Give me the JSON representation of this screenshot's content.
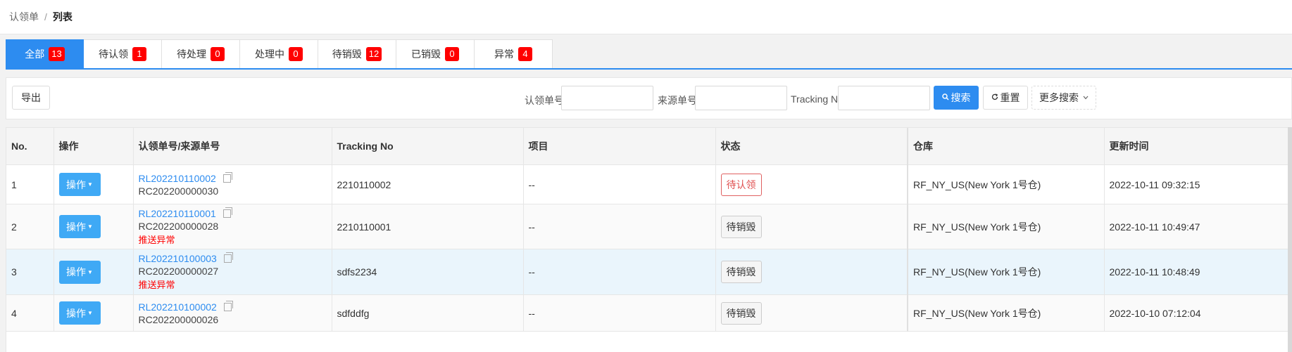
{
  "breadcrumb": {
    "parent": "认领单",
    "separator": "/",
    "current": "列表"
  },
  "tabs": [
    {
      "label": "全部",
      "count": "13",
      "active": true
    },
    {
      "label": "待认领",
      "count": "1"
    },
    {
      "label": "待处理",
      "count": "0"
    },
    {
      "label": "处理中",
      "count": "0"
    },
    {
      "label": "待销毁",
      "count": "12"
    },
    {
      "label": "已销毁",
      "count": "0"
    },
    {
      "label": "异常",
      "count": "4"
    }
  ],
  "toolbar": {
    "export_label": "导出",
    "claim_no_label": "认领单号",
    "claim_no_value": "",
    "source_no_label": "来源单号",
    "source_no_value": "",
    "tracking_label": "Tracking No",
    "tracking_value": "",
    "search_label": "搜索",
    "search_icon": "search-icon",
    "reset_label": "重置",
    "reset_icon": "refresh-icon",
    "more_search_label": "更多搜索",
    "more_search_icon": "chevron-down-icon"
  },
  "table": {
    "headers": {
      "no": "No.",
      "operation": "操作",
      "order_no": "认领单号/来源单号",
      "tracking": "Tracking No",
      "item": "项目",
      "status": "状态",
      "warehouse": "仓库",
      "updated": "更新时间"
    },
    "rows": [
      {
        "no": "1",
        "op_label": "操作",
        "claim_no": "RL202210110002",
        "source_no": "RC202200000030",
        "error": "",
        "tracking": "2210110002",
        "item": "--",
        "status": "待认领",
        "status_style": "warn",
        "warehouse": "RF_NY_US(New York 1号仓)",
        "updated": "2022-10-11 09:32:15"
      },
      {
        "no": "2",
        "op_label": "操作",
        "claim_no": "RL202210110001",
        "source_no": "RC202200000028",
        "error": "推送异常",
        "tracking": "2210110001",
        "item": "--",
        "status": "待销毁",
        "status_style": "normal",
        "warehouse": "RF_NY_US(New York 1号仓)",
        "updated": "2022-10-11 10:49:47"
      },
      {
        "no": "3",
        "op_label": "操作",
        "claim_no": "RL202210100003",
        "source_no": "RC202200000027",
        "error": "推送异常",
        "tracking": "sdfs2234",
        "item": "--",
        "status": "待销毁",
        "status_style": "normal",
        "warehouse": "RF_NY_US(New York 1号仓)",
        "updated": "2022-10-11 10:48:49"
      },
      {
        "no": "4",
        "op_label": "操作",
        "claim_no": "RL202210100002",
        "source_no": "RC202200000026",
        "error": "",
        "tracking": "sdfddfg",
        "item": "--",
        "status": "待销毁",
        "status_style": "normal",
        "warehouse": "RF_NY_US(New York 1号仓)",
        "updated": "2022-10-10 07:12:04"
      }
    ]
  },
  "colors": {
    "primary": "#2d8cf0",
    "badge": "#ff0000",
    "op_button": "#3fa9f5",
    "error_text": "#ff0000"
  }
}
